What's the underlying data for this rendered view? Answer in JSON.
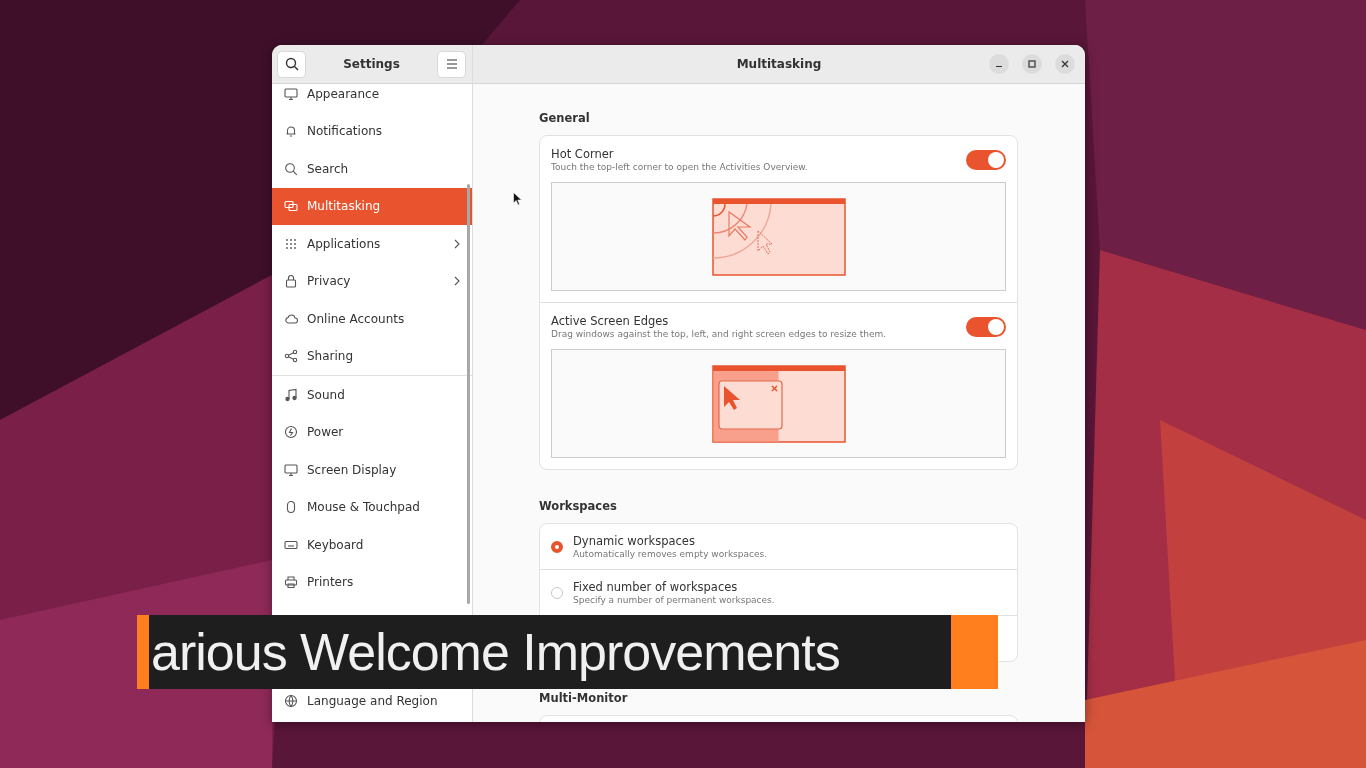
{
  "window": {
    "title": "Multitasking"
  },
  "sidebar": {
    "title": "Settings",
    "groups": [
      {
        "items": [
          {
            "label": "Appearance",
            "selected": false,
            "submenu": false
          },
          {
            "label": "Notifications",
            "selected": false,
            "submenu": false
          },
          {
            "label": "Search",
            "selected": false,
            "submenu": false
          },
          {
            "label": "Multitasking",
            "selected": true,
            "submenu": false
          },
          {
            "label": "Applications",
            "selected": false,
            "submenu": true
          },
          {
            "label": "Privacy",
            "selected": false,
            "submenu": true
          },
          {
            "label": "Online Accounts",
            "selected": false,
            "submenu": false
          },
          {
            "label": "Sharing",
            "selected": false,
            "submenu": false
          }
        ]
      },
      {
        "items": [
          {
            "label": "Sound",
            "selected": false,
            "submenu": false
          },
          {
            "label": "Power",
            "selected": false,
            "submenu": false
          },
          {
            "label": "Screen Display",
            "selected": false,
            "submenu": false
          },
          {
            "label": "Mouse & Touchpad",
            "selected": false,
            "submenu": false
          },
          {
            "label": "Keyboard",
            "selected": false,
            "submenu": false
          },
          {
            "label": "Printers",
            "selected": false,
            "submenu": false
          }
        ]
      }
    ],
    "bottom_item": {
      "label": "Language and Region"
    }
  },
  "sections": [
    {
      "heading": "General",
      "kind": "toggles",
      "rows": [
        {
          "kind": "hot_corner",
          "title": "Hot Corner",
          "description": "Touch the top-left corner to open the Activities Overview.",
          "on": true
        },
        {
          "kind": "screen_edges",
          "title": "Active Screen Edges",
          "description": "Drag windows against the top, left, and right screen edges to resize them.",
          "on": true
        }
      ]
    },
    {
      "heading": "Workspaces",
      "kind": "radios",
      "rows": [
        {
          "title": "Dynamic workspaces",
          "description": "Automatically removes empty workspaces.",
          "selected": true
        },
        {
          "title": "Fixed number of workspaces",
          "description": "Specify a number of permanent workspaces.",
          "selected": false
        }
      ]
    },
    {
      "heading": "Multi-Monitor",
      "kind": "cut"
    }
  ],
  "caption": {
    "text": "arious Welcome Improvements"
  }
}
